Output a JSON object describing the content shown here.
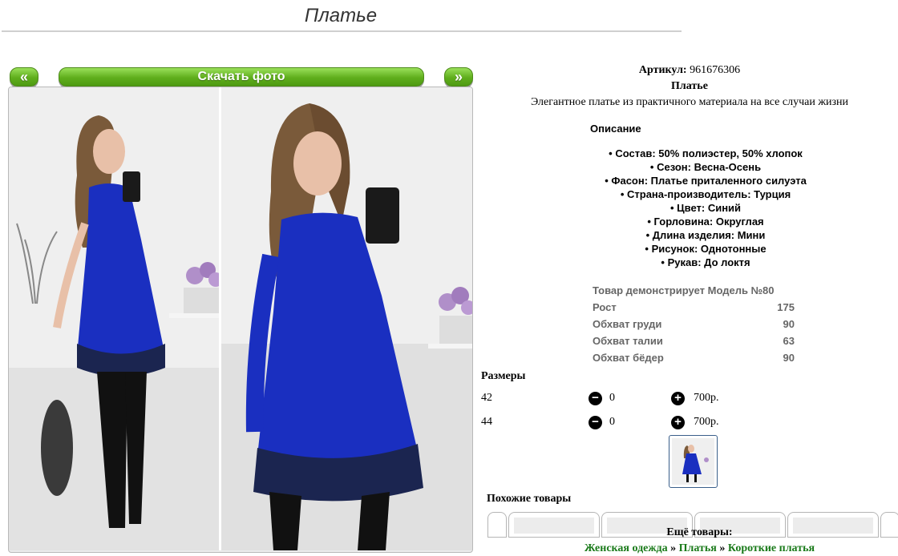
{
  "page": {
    "title": "Платье"
  },
  "toolbar": {
    "prev_label": "«",
    "download_label": "Скачать фото",
    "next_label": "»"
  },
  "product": {
    "sku_label": "Артикул:",
    "sku_value": "961676306",
    "name": "Платье",
    "short_description": "Элегантное платье из практичного материала на все случаи жизни",
    "description_heading": "Описание",
    "features": [
      "Состав: 50% полиэстер, 50% хлопок",
      "Сезон: Весна-Осень",
      "Фасон: Платье приталенного силуэта",
      "Страна-производитель: Турция",
      "Цвет: Синий",
      "Горловина: Округлая",
      "Длина изделия: Мини",
      "Рисунок: Однотонные",
      "Рукав: До локтя"
    ],
    "bullet": "•"
  },
  "model": {
    "heading": "Товар демонстрирует Модель №80",
    "rows": [
      {
        "label": "Рост",
        "value": "175"
      },
      {
        "label": "Обхват груди",
        "value": "90"
      },
      {
        "label": "Обхват талии",
        "value": "63"
      },
      {
        "label": "Обхват бёдер",
        "value": "90"
      }
    ]
  },
  "sizes": {
    "heading": "Размеры",
    "minus_symbol": "−",
    "plus_symbol": "+",
    "rows": [
      {
        "size": "42",
        "qty": "0",
        "price": "700р."
      },
      {
        "size": "44",
        "qty": "0",
        "price": "700р."
      }
    ]
  },
  "similar": {
    "heading": "Похожие товары"
  },
  "more": {
    "label": "Ещё товары:",
    "breadcrumb": [
      "Женская одежда",
      "Платья",
      "Короткие платья"
    ],
    "separator": "»"
  },
  "icons": {
    "minus": "minus-circle-icon",
    "plus": "plus-circle-icon"
  },
  "colors": {
    "accent_green": "#5fae1c",
    "dress_blue": "#1a2fc0",
    "link_green": "#1a7a1a"
  }
}
